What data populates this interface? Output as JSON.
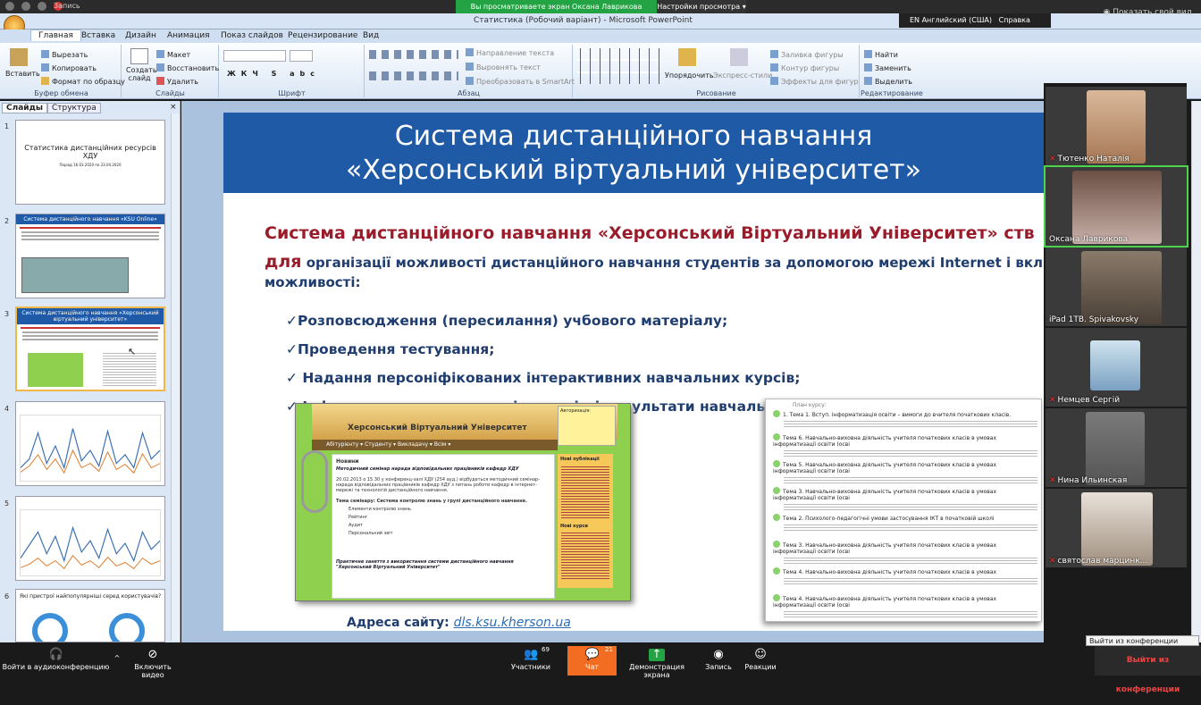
{
  "zoom": {
    "recording_label": "Запись",
    "banner": "Вы просматриваете экран Оксана Лаврикова",
    "view_options": "Настройки просмотра",
    "show_view": "Показать свой вид",
    "language": "EN Английский (США)",
    "help": "Справка"
  },
  "window": {
    "title": "Статистика (Робочий варіант) - Microsoft PowerPoint"
  },
  "ribbon": {
    "tabs": [
      "Главная",
      "Вставка",
      "Дизайн",
      "Анимация",
      "Показ слайдов",
      "Рецензирование",
      "Вид"
    ],
    "clipboard": {
      "label": "Буфер обмена",
      "paste": "Вставить",
      "cut": "Вырезать",
      "copy": "Копировать",
      "format": "Формат по образцу"
    },
    "slides": {
      "label": "Слайды",
      "create": "Создать слайд",
      "layout": "Макет",
      "reset": "Восстановить",
      "delete": "Удалить"
    },
    "font": {
      "label": "Шрифт"
    },
    "paragraph": {
      "label": "Абзац",
      "direction": "Направление текста",
      "align": "Выровнять текст",
      "smartart": "Преобразовать в SmartArt"
    },
    "drawing": {
      "label": "Рисование",
      "arrange": "Упорядочить",
      "styles": "Экспресс-стили",
      "fill": "Заливка фигуры",
      "outline": "Контур фигуры",
      "effects": "Эффекты для фигур"
    },
    "editing": {
      "label": "Редактирование",
      "find": "Найти",
      "replace": "Заменить",
      "select": "Выделить"
    }
  },
  "panel": {
    "tabs": [
      "Слайды",
      "Структура"
    ],
    "thumbs": [
      {
        "num": "1",
        "title": "Статистика дистанційних ресурсів ХДУ",
        "sub": "Період 16.03.2020 по 23.04.2020"
      },
      {
        "num": "2",
        "title": "Система дистанційного навчання «KSU Online»"
      },
      {
        "num": "3",
        "title": "Система дистанційного навчання «Херсонський віртуальний університет»"
      },
      {
        "num": "4",
        "title": ""
      },
      {
        "num": "5",
        "title": ""
      },
      {
        "num": "6",
        "title": "Які пристрої найпопулярніші серед користувачів?"
      }
    ]
  },
  "slide": {
    "header_line1": "Система дистанційного навчання",
    "header_line2": "«Херсонський віртуальний університет»",
    "title": "Система дистанційного навчання «Херсонський Віртуальний Університет» ств",
    "body_prefix": "для",
    "body_text": " організації можливості дистанційного навчання студентів за допомогою мережі Internet і включа",
    "body_line2": "можливості:",
    "bullets": [
      "✓Розповсюдження (пересилання) учбового матеріалу;",
      "✓Проведення тестування;",
      "✓ Надання персоніфікованих інтерактивних навчальних курсів;",
      "✓ Інформування користувачів про хід і результати навчального процесу;"
    ],
    "url_label": "Адреса сайту:",
    "url": "dls.ksu.kherson.ua",
    "site": {
      "name": "Херсонський Віртуальний Університет",
      "nav": "Абітурієнту ▾   Студенту ▾   Викладачу ▾   Всім ▾",
      "news": "Новини",
      "login": "Авторизація:",
      "news_title": "Методичний семінар нарада відповідальних працівників кафедр ХДУ",
      "news_text": "20.02.2013 о 15.30 у конференц-залі ХДУ (254 ауд.) відбудеться методичний семінар-нарада відповідальних працівників кафедр ХДУ з питань роботи кафедр в інтернет-мережі та технологій дистанційного навчання.",
      "topic": "Тема семінару: Система контролю знань у групі дистанційного навчання.",
      "items": [
        "Елементи контролю знань",
        "Рейтинг",
        "Аудит",
        "Персональний звіт"
      ],
      "footer": "Практичне заняття з використання системи дистанційного навчання \"Херсонський Віртуальний Університет\"",
      "new_pubs": "Нові публікації",
      "new_courses": "Нові курси"
    },
    "course_plan_title": "План курсу:",
    "course_rows": [
      "1. Тема 1. Вступ. Інформатизація освіти – вимоги до вчителя початкових класів.",
      "Тема 6. Навчально-виховна діяльність учителя початкових класів в умовах інформатизації освіти (осві",
      "Тема 5. Навчально-виховна діяльність учителя початкових класів в умовах інформатизації освіти (осві",
      "Тема 3. Навчально-виховна діяльність учителя початкових класів в умовах інформатизації освіти (осві",
      "Тема 2. Психолого-педагогічні умови застосування ІКТ в початковій школі",
      "Тема 3. Навчально-виховна діяльність учителя початкових класів в умовах інформатизації освіти (осві",
      "Тема 4. Навчально-виховна діяльність учителя початкових класів в умовах",
      "Тема 4. Навчально-виховна діяльність учителя початкових класів в умовах інформатизації освіти (осві"
    ]
  },
  "participants": [
    {
      "name": "Тютенко Наталія",
      "muted": true
    },
    {
      "name": "Оксана Лаврикова",
      "muted": false,
      "active": true
    },
    {
      "name": "iPad 1TB. Spivakovsky",
      "muted": false
    },
    {
      "name": "Немцев Сергій",
      "muted": true
    },
    {
      "name": "Нина Ильинская",
      "muted": true
    },
    {
      "name": "святослав марцинк...",
      "muted": true
    }
  ],
  "tooltip": "Выйти из конференции (Alt+Q)",
  "toolbar": {
    "audio": "Войти в аудиоконференцию",
    "video": "Включить видео",
    "participants": "Участники",
    "participants_count": "69",
    "chat": "Чат",
    "chat_count": "21",
    "share": "Демонстрация экрана",
    "record": "Запись",
    "reactions": "Реакции",
    "leave": "Выйти из конференции"
  },
  "colors": {
    "accent_green": "#23a344",
    "slide_blue": "#1f5aa7",
    "title_red": "#9a1c2b",
    "chat_orange": "#f26d21"
  }
}
